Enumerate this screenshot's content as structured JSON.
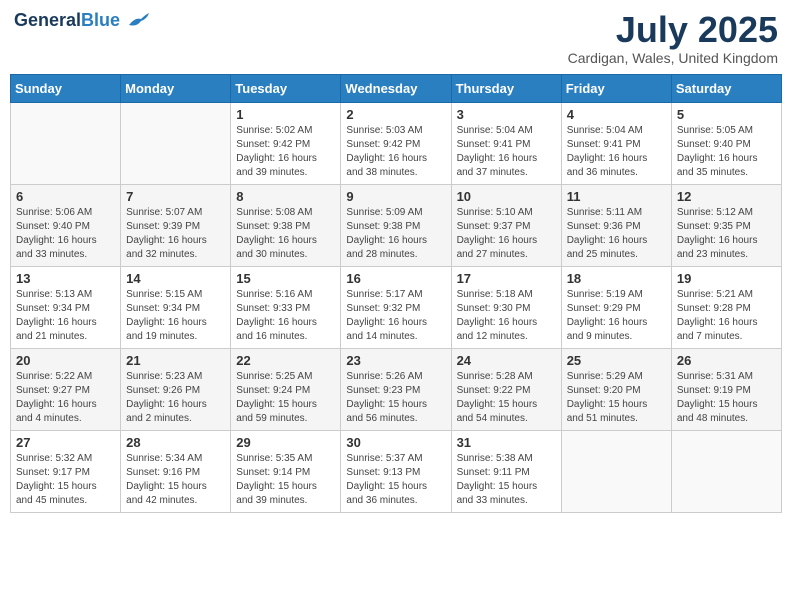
{
  "header": {
    "logo_line1": "General",
    "logo_line2": "Blue",
    "month_title": "July 2025",
    "location": "Cardigan, Wales, United Kingdom"
  },
  "days_of_week": [
    "Sunday",
    "Monday",
    "Tuesday",
    "Wednesday",
    "Thursday",
    "Friday",
    "Saturday"
  ],
  "weeks": [
    [
      {
        "day": "",
        "info": ""
      },
      {
        "day": "",
        "info": ""
      },
      {
        "day": "1",
        "info": "Sunrise: 5:02 AM\nSunset: 9:42 PM\nDaylight: 16 hours\nand 39 minutes."
      },
      {
        "day": "2",
        "info": "Sunrise: 5:03 AM\nSunset: 9:42 PM\nDaylight: 16 hours\nand 38 minutes."
      },
      {
        "day": "3",
        "info": "Sunrise: 5:04 AM\nSunset: 9:41 PM\nDaylight: 16 hours\nand 37 minutes."
      },
      {
        "day": "4",
        "info": "Sunrise: 5:04 AM\nSunset: 9:41 PM\nDaylight: 16 hours\nand 36 minutes."
      },
      {
        "day": "5",
        "info": "Sunrise: 5:05 AM\nSunset: 9:40 PM\nDaylight: 16 hours\nand 35 minutes."
      }
    ],
    [
      {
        "day": "6",
        "info": "Sunrise: 5:06 AM\nSunset: 9:40 PM\nDaylight: 16 hours\nand 33 minutes."
      },
      {
        "day": "7",
        "info": "Sunrise: 5:07 AM\nSunset: 9:39 PM\nDaylight: 16 hours\nand 32 minutes."
      },
      {
        "day": "8",
        "info": "Sunrise: 5:08 AM\nSunset: 9:38 PM\nDaylight: 16 hours\nand 30 minutes."
      },
      {
        "day": "9",
        "info": "Sunrise: 5:09 AM\nSunset: 9:38 PM\nDaylight: 16 hours\nand 28 minutes."
      },
      {
        "day": "10",
        "info": "Sunrise: 5:10 AM\nSunset: 9:37 PM\nDaylight: 16 hours\nand 27 minutes."
      },
      {
        "day": "11",
        "info": "Sunrise: 5:11 AM\nSunset: 9:36 PM\nDaylight: 16 hours\nand 25 minutes."
      },
      {
        "day": "12",
        "info": "Sunrise: 5:12 AM\nSunset: 9:35 PM\nDaylight: 16 hours\nand 23 minutes."
      }
    ],
    [
      {
        "day": "13",
        "info": "Sunrise: 5:13 AM\nSunset: 9:34 PM\nDaylight: 16 hours\nand 21 minutes."
      },
      {
        "day": "14",
        "info": "Sunrise: 5:15 AM\nSunset: 9:34 PM\nDaylight: 16 hours\nand 19 minutes."
      },
      {
        "day": "15",
        "info": "Sunrise: 5:16 AM\nSunset: 9:33 PM\nDaylight: 16 hours\nand 16 minutes."
      },
      {
        "day": "16",
        "info": "Sunrise: 5:17 AM\nSunset: 9:32 PM\nDaylight: 16 hours\nand 14 minutes."
      },
      {
        "day": "17",
        "info": "Sunrise: 5:18 AM\nSunset: 9:30 PM\nDaylight: 16 hours\nand 12 minutes."
      },
      {
        "day": "18",
        "info": "Sunrise: 5:19 AM\nSunset: 9:29 PM\nDaylight: 16 hours\nand 9 minutes."
      },
      {
        "day": "19",
        "info": "Sunrise: 5:21 AM\nSunset: 9:28 PM\nDaylight: 16 hours\nand 7 minutes."
      }
    ],
    [
      {
        "day": "20",
        "info": "Sunrise: 5:22 AM\nSunset: 9:27 PM\nDaylight: 16 hours\nand 4 minutes."
      },
      {
        "day": "21",
        "info": "Sunrise: 5:23 AM\nSunset: 9:26 PM\nDaylight: 16 hours\nand 2 minutes."
      },
      {
        "day": "22",
        "info": "Sunrise: 5:25 AM\nSunset: 9:24 PM\nDaylight: 15 hours\nand 59 minutes."
      },
      {
        "day": "23",
        "info": "Sunrise: 5:26 AM\nSunset: 9:23 PM\nDaylight: 15 hours\nand 56 minutes."
      },
      {
        "day": "24",
        "info": "Sunrise: 5:28 AM\nSunset: 9:22 PM\nDaylight: 15 hours\nand 54 minutes."
      },
      {
        "day": "25",
        "info": "Sunrise: 5:29 AM\nSunset: 9:20 PM\nDaylight: 15 hours\nand 51 minutes."
      },
      {
        "day": "26",
        "info": "Sunrise: 5:31 AM\nSunset: 9:19 PM\nDaylight: 15 hours\nand 48 minutes."
      }
    ],
    [
      {
        "day": "27",
        "info": "Sunrise: 5:32 AM\nSunset: 9:17 PM\nDaylight: 15 hours\nand 45 minutes."
      },
      {
        "day": "28",
        "info": "Sunrise: 5:34 AM\nSunset: 9:16 PM\nDaylight: 15 hours\nand 42 minutes."
      },
      {
        "day": "29",
        "info": "Sunrise: 5:35 AM\nSunset: 9:14 PM\nDaylight: 15 hours\nand 39 minutes."
      },
      {
        "day": "30",
        "info": "Sunrise: 5:37 AM\nSunset: 9:13 PM\nDaylight: 15 hours\nand 36 minutes."
      },
      {
        "day": "31",
        "info": "Sunrise: 5:38 AM\nSunset: 9:11 PM\nDaylight: 15 hours\nand 33 minutes."
      },
      {
        "day": "",
        "info": ""
      },
      {
        "day": "",
        "info": ""
      }
    ]
  ]
}
